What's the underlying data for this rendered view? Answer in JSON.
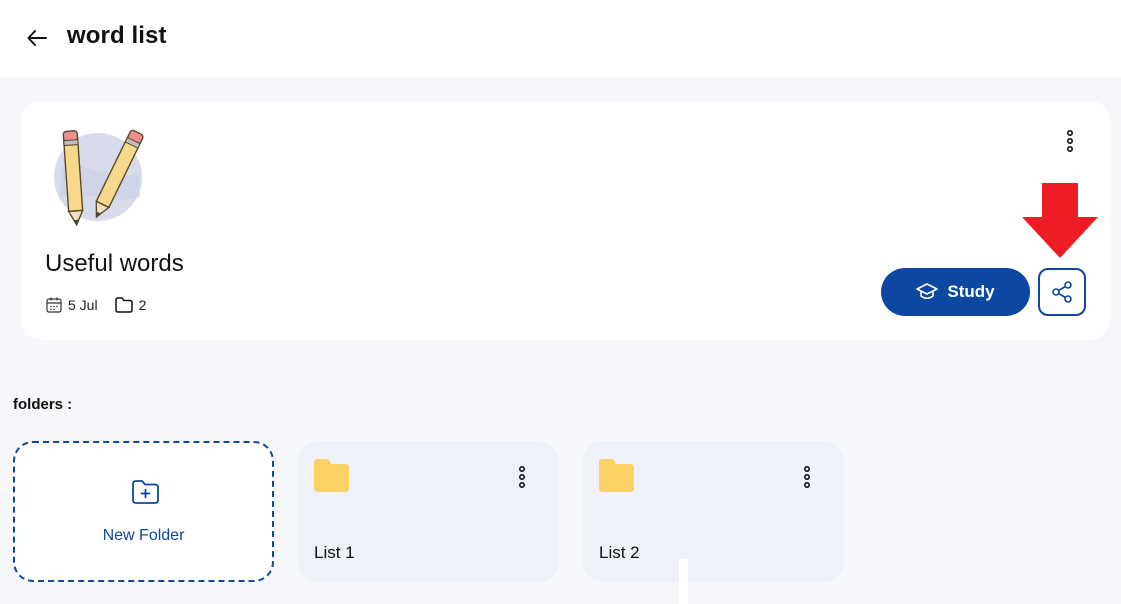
{
  "header": {
    "title": "word list",
    "back_icon": "arrow-left-icon"
  },
  "card": {
    "title": "Useful words",
    "date": "5 Jul",
    "folder_count": "2",
    "study_label": "Study",
    "share_icon": "share-icon",
    "more_icon": "more-vertical-icon"
  },
  "folders_section": {
    "label": "folders :",
    "new_folder_label": "New Folder",
    "items": [
      {
        "name": "List 1"
      },
      {
        "name": "List 2"
      }
    ]
  },
  "colors": {
    "primary": "#0c47a1",
    "folder": "#fbd166",
    "annotation_arrow": "#ee1c25"
  }
}
